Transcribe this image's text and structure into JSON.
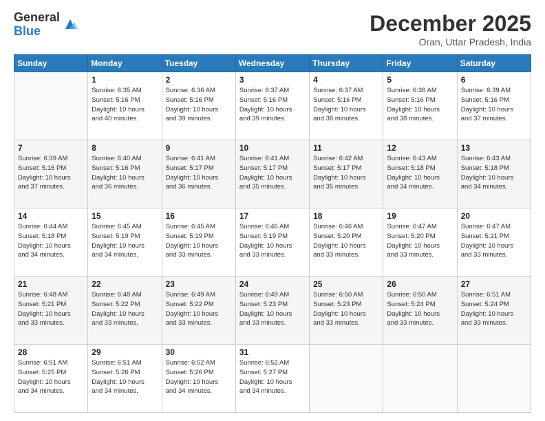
{
  "logo": {
    "general": "General",
    "blue": "Blue"
  },
  "title": "December 2025",
  "subtitle": "Oran, Uttar Pradesh, India",
  "days_header": [
    "Sunday",
    "Monday",
    "Tuesday",
    "Wednesday",
    "Thursday",
    "Friday",
    "Saturday"
  ],
  "weeks": [
    [
      {
        "num": "",
        "info": ""
      },
      {
        "num": "1",
        "info": "Sunrise: 6:35 AM\nSunset: 5:16 PM\nDaylight: 10 hours\nand 40 minutes."
      },
      {
        "num": "2",
        "info": "Sunrise: 6:36 AM\nSunset: 5:16 PM\nDaylight: 10 hours\nand 39 minutes."
      },
      {
        "num": "3",
        "info": "Sunrise: 6:37 AM\nSunset: 5:16 PM\nDaylight: 10 hours\nand 39 minutes."
      },
      {
        "num": "4",
        "info": "Sunrise: 6:37 AM\nSunset: 5:16 PM\nDaylight: 10 hours\nand 38 minutes."
      },
      {
        "num": "5",
        "info": "Sunrise: 6:38 AM\nSunset: 5:16 PM\nDaylight: 10 hours\nand 38 minutes."
      },
      {
        "num": "6",
        "info": "Sunrise: 6:39 AM\nSunset: 5:16 PM\nDaylight: 10 hours\nand 37 minutes."
      }
    ],
    [
      {
        "num": "7",
        "info": "Sunrise: 6:39 AM\nSunset: 5:16 PM\nDaylight: 10 hours\nand 37 minutes."
      },
      {
        "num": "8",
        "info": "Sunrise: 6:40 AM\nSunset: 5:16 PM\nDaylight: 10 hours\nand 36 minutes."
      },
      {
        "num": "9",
        "info": "Sunrise: 6:41 AM\nSunset: 5:17 PM\nDaylight: 10 hours\nand 36 minutes."
      },
      {
        "num": "10",
        "info": "Sunrise: 6:41 AM\nSunset: 5:17 PM\nDaylight: 10 hours\nand 35 minutes."
      },
      {
        "num": "11",
        "info": "Sunrise: 6:42 AM\nSunset: 5:17 PM\nDaylight: 10 hours\nand 35 minutes."
      },
      {
        "num": "12",
        "info": "Sunrise: 6:43 AM\nSunset: 5:18 PM\nDaylight: 10 hours\nand 34 minutes."
      },
      {
        "num": "13",
        "info": "Sunrise: 6:43 AM\nSunset: 5:18 PM\nDaylight: 10 hours\nand 34 minutes."
      }
    ],
    [
      {
        "num": "14",
        "info": "Sunrise: 6:44 AM\nSunset: 5:18 PM\nDaylight: 10 hours\nand 34 minutes."
      },
      {
        "num": "15",
        "info": "Sunrise: 6:45 AM\nSunset: 5:19 PM\nDaylight: 10 hours\nand 34 minutes."
      },
      {
        "num": "16",
        "info": "Sunrise: 6:45 AM\nSunset: 5:19 PM\nDaylight: 10 hours\nand 33 minutes."
      },
      {
        "num": "17",
        "info": "Sunrise: 6:46 AM\nSunset: 5:19 PM\nDaylight: 10 hours\nand 33 minutes."
      },
      {
        "num": "18",
        "info": "Sunrise: 6:46 AM\nSunset: 5:20 PM\nDaylight: 10 hours\nand 33 minutes."
      },
      {
        "num": "19",
        "info": "Sunrise: 6:47 AM\nSunset: 5:20 PM\nDaylight: 10 hours\nand 33 minutes."
      },
      {
        "num": "20",
        "info": "Sunrise: 6:47 AM\nSunset: 5:21 PM\nDaylight: 10 hours\nand 33 minutes."
      }
    ],
    [
      {
        "num": "21",
        "info": "Sunrise: 6:48 AM\nSunset: 5:21 PM\nDaylight: 10 hours\nand 33 minutes."
      },
      {
        "num": "22",
        "info": "Sunrise: 6:48 AM\nSunset: 5:22 PM\nDaylight: 10 hours\nand 33 minutes."
      },
      {
        "num": "23",
        "info": "Sunrise: 6:49 AM\nSunset: 5:22 PM\nDaylight: 10 hours\nand 33 minutes."
      },
      {
        "num": "24",
        "info": "Sunrise: 6:49 AM\nSunset: 5:23 PM\nDaylight: 10 hours\nand 33 minutes."
      },
      {
        "num": "25",
        "info": "Sunrise: 6:50 AM\nSunset: 5:23 PM\nDaylight: 10 hours\nand 33 minutes."
      },
      {
        "num": "26",
        "info": "Sunrise: 6:50 AM\nSunset: 5:24 PM\nDaylight: 10 hours\nand 33 minutes."
      },
      {
        "num": "27",
        "info": "Sunrise: 6:51 AM\nSunset: 5:24 PM\nDaylight: 10 hours\nand 33 minutes."
      }
    ],
    [
      {
        "num": "28",
        "info": "Sunrise: 6:51 AM\nSunset: 5:25 PM\nDaylight: 10 hours\nand 34 minutes."
      },
      {
        "num": "29",
        "info": "Sunrise: 6:51 AM\nSunset: 5:26 PM\nDaylight: 10 hours\nand 34 minutes."
      },
      {
        "num": "30",
        "info": "Sunrise: 6:52 AM\nSunset: 5:26 PM\nDaylight: 10 hours\nand 34 minutes."
      },
      {
        "num": "31",
        "info": "Sunrise: 6:52 AM\nSunset: 5:27 PM\nDaylight: 10 hours\nand 34 minutes."
      },
      {
        "num": "",
        "info": ""
      },
      {
        "num": "",
        "info": ""
      },
      {
        "num": "",
        "info": ""
      }
    ]
  ]
}
